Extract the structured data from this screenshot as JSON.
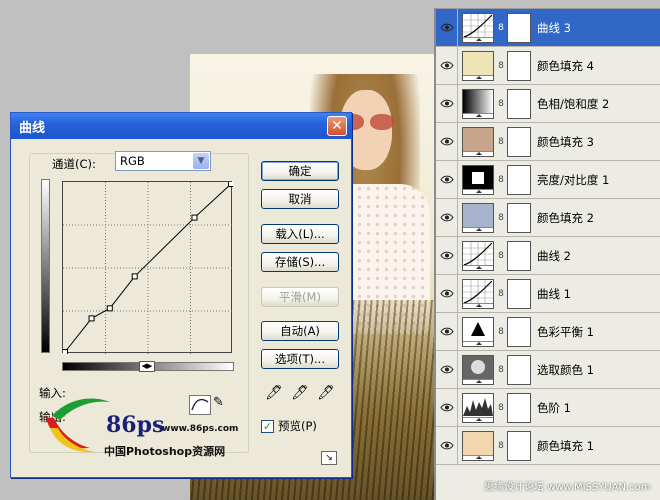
{
  "layers": [
    {
      "name": "曲线 3",
      "thumb": "curves",
      "selected": true
    },
    {
      "name": "颜色填充 4",
      "thumb": "fill",
      "color": "#efe4b6"
    },
    {
      "name": "色相/饱和度 2",
      "thumb": "hue"
    },
    {
      "name": "颜色填充 3",
      "thumb": "fill",
      "color": "#c7a48c"
    },
    {
      "name": "亮度/对比度 1",
      "thumb": "bright"
    },
    {
      "name": "颜色填充 2",
      "thumb": "fill",
      "color": "#a7b2cd"
    },
    {
      "name": "曲线 2",
      "thumb": "curves"
    },
    {
      "name": "曲线 1",
      "thumb": "curves"
    },
    {
      "name": "色彩平衡 1",
      "thumb": "balance"
    },
    {
      "name": "选取颜色 1",
      "thumb": "selective"
    },
    {
      "name": "色阶 1",
      "thumb": "levels"
    },
    {
      "name": "颜色填充 1",
      "thumb": "fill",
      "color": "#f2d6ae"
    }
  ],
  "dialog": {
    "title": "曲线",
    "close_glyph": "✕",
    "channel_label": "通道(C):",
    "channel_value": "RGB",
    "input_label": "输入:",
    "output_label": "输出:",
    "buttons": {
      "ok": "确定",
      "cancel": "取消",
      "load": "载入(L)...",
      "save": "存储(S)...",
      "smooth": "平滑(M)",
      "auto": "自动(A)",
      "options": "选项(T)..."
    },
    "preview_label": "预览(P)",
    "preview_checked": true,
    "curve_points": [
      [
        0,
        0
      ],
      [
        0.16,
        0.2
      ],
      [
        0.27,
        0.26
      ],
      [
        0.42,
        0.45
      ],
      [
        0.78,
        0.8
      ],
      [
        1,
        1
      ]
    ]
  },
  "watermark": {
    "logo_number": "86ps",
    "site": "www.86ps.com",
    "cn_name": "中国Photoshop资源网",
    "footer": "思缘设计论坛 www.MISSYUAN.com"
  }
}
